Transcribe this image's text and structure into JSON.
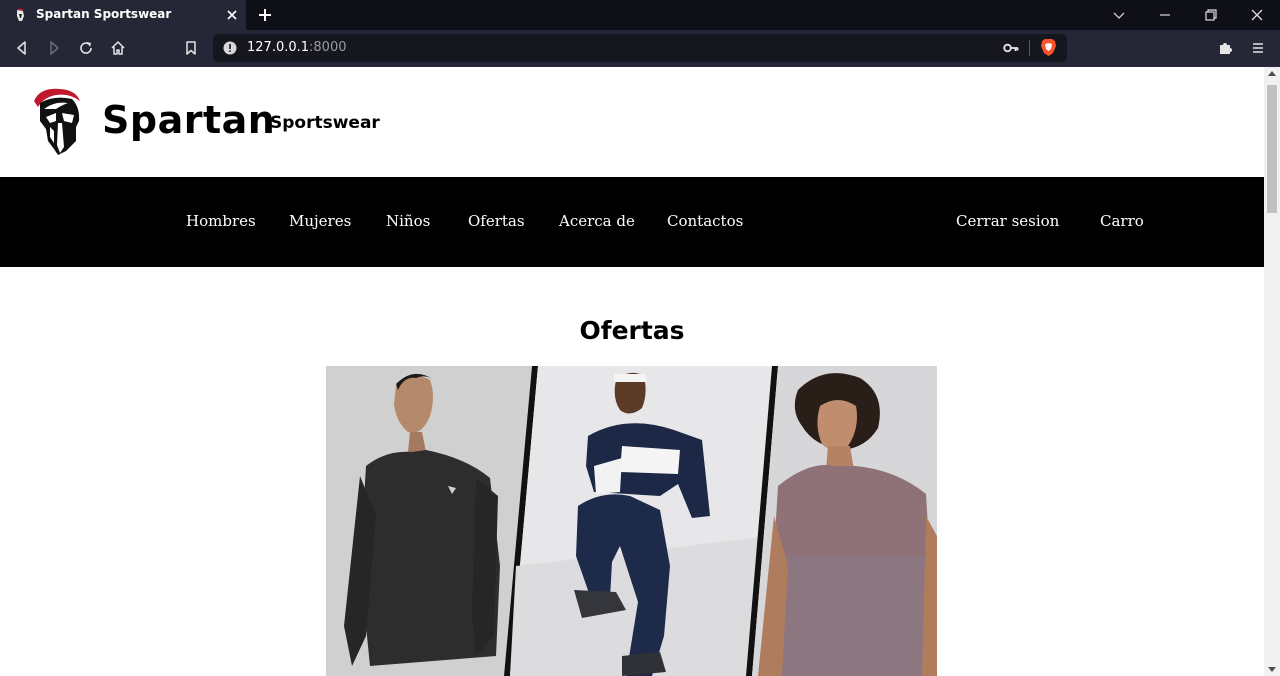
{
  "browser": {
    "tab_title": "Spartan Sportswear",
    "url_host": "127.0.0.1",
    "url_port": ":8000"
  },
  "header": {
    "brand": "Spartan",
    "brand_sub": "Sportswear"
  },
  "nav": {
    "items": [
      "Hombres",
      "Mujeres",
      "Niños",
      "Ofertas",
      "Acerca de",
      "Contactos"
    ],
    "logout": "Cerrar sesion",
    "cart": "Carro"
  },
  "main": {
    "section_title": "Ofertas"
  },
  "colors": {
    "chrome_dark": "#0f0f18",
    "chrome_tab": "#262736",
    "nav_bg": "#000000",
    "helmet_plume": "#c0182c"
  },
  "icons": [
    "back-icon",
    "forward-icon",
    "reload-icon",
    "home-icon",
    "bookmark-icon",
    "info-icon",
    "key-icon",
    "brave-shield-icon",
    "extensions-icon",
    "menu-icon",
    "close-icon",
    "new-tab-icon",
    "minimize-icon",
    "restore-icon",
    "chevron-down-icon"
  ]
}
